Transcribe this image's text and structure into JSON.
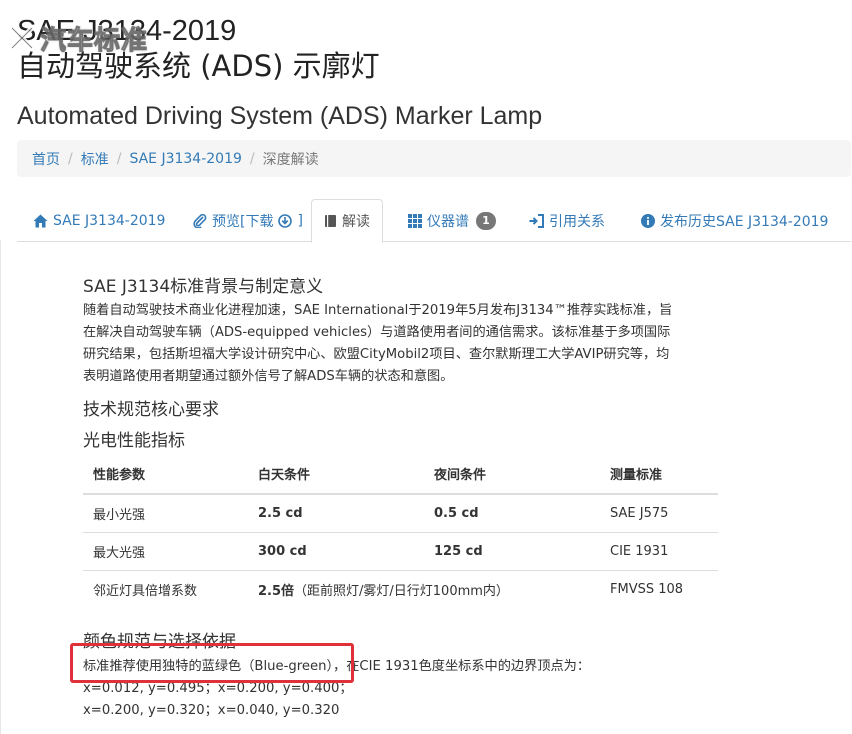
{
  "header": {
    "code": "SAE J3134-2019",
    "title_cn": "自动驾驶系统 (ADS) 示廓灯",
    "title_en": "Automated Driving System (ADS) Marker Lamp",
    "watermark": "汽车标准"
  },
  "breadcrumb": {
    "items": [
      "首页",
      "标准",
      "SAE J3134-2019"
    ],
    "current": "深度解读"
  },
  "tabs": [
    {
      "label": "SAE J3134-2019",
      "icon": "home-icon"
    },
    {
      "label": "预览[下载",
      "icon": "paperclip-icon"
    },
    {
      "label": "解读",
      "icon": "book-icon",
      "active": true
    },
    {
      "label": "仪器谱",
      "icon": "grid-icon",
      "badge": "1"
    },
    {
      "label": "引用关系",
      "icon": "sign-in-icon"
    },
    {
      "label": "发布历史SAE J3134-2019",
      "icon": "info-circle-icon"
    }
  ],
  "article": {
    "h_background": "SAE J3134标准背景与制定意义",
    "para_background": [
      "随着自动驾驶技术商业化进程加速，SAE International于2019年5月发布J3134™推荐实践标准，旨",
      "在解决自动驾驶车辆（ADS-equipped vehicles）与道路使用者间的通信需求。该标准基于多项国际",
      "研究结果，包括斯坦福大学设计研究中心、欧盟CityMobil2项目、查尔默斯理工大学AVIP研究等，均",
      "表明道路使用者期望通过额外信号了解ADS车辆的状态和意图。"
    ],
    "h_requirements": "技术规范核心要求",
    "h_photometric": "光电性能指标",
    "table": {
      "headers": [
        "性能参数",
        "白天条件",
        "夜间条件",
        "测量标准"
      ],
      "rows": [
        {
          "param": "最小光强",
          "day": "2.5 cd",
          "night": "0.5 cd",
          "standard": "SAE J575"
        },
        {
          "param": "最大光强",
          "day": "300 cd",
          "night": "125 cd",
          "standard": "CIE 1931"
        },
        {
          "param": "邻近灯具倍增系数",
          "day": "2.5倍",
          "night": "（距前照灯/雾灯/日行灯100mm内）",
          "standard": "FMVSS 108"
        }
      ]
    },
    "h_color": "颜色规范与选择依据",
    "color_line1_highlight": "标准推荐使用独特的蓝绿色（Blue-green），",
    "color_line1_rest": "在CIE 1931色度坐标系中的边界顶点为：",
    "color_line2": "x=0.012, y=0.495；x=0.200, y=0.400；",
    "color_line3": "x=0.200, y=0.320；x=0.040, y=0.320"
  },
  "colors": {
    "link": "#337ab7",
    "highlight_box": "#e0303a",
    "badge": "#777777"
  }
}
